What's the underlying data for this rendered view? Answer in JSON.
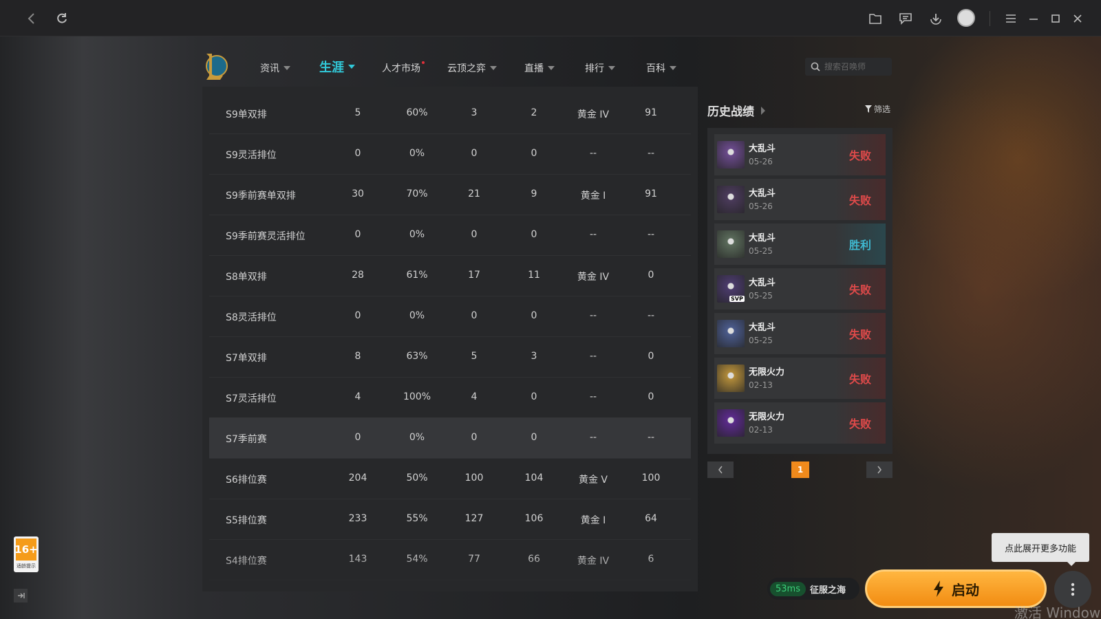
{
  "icons": {
    "back": "back-arrow-icon",
    "refresh": "refresh-icon",
    "folder": "folder-icon",
    "chat": "chat-icon",
    "download": "download-icon",
    "menu": "menu-icon",
    "minimize": "minimize-icon",
    "maximize": "maximize-icon",
    "close": "close-icon",
    "search": "search-icon",
    "filter": "filter-icon",
    "launch": "lightning-icon"
  },
  "nav": {
    "items": [
      {
        "label": "资讯",
        "caret": true
      },
      {
        "label": "生涯",
        "caret": true,
        "active": true
      },
      {
        "label": "人才市场",
        "dot": true
      },
      {
        "label": "云顶之弈",
        "caret": true
      },
      {
        "label": "直播",
        "caret": true
      },
      {
        "label": "排行",
        "caret": true
      },
      {
        "label": "百科",
        "caret": true
      }
    ],
    "search_placeholder": "搜索召唤师"
  },
  "seasons": [
    [
      "S9单双排",
      "5",
      "60%",
      "3",
      "2",
      "黄金 IV",
      "91"
    ],
    [
      "S9灵活排位",
      "0",
      "0%",
      "0",
      "0",
      "--",
      "--"
    ],
    [
      "S9季前赛单双排",
      "30",
      "70%",
      "21",
      "9",
      "黄金 I",
      "91"
    ],
    [
      "S9季前赛灵活排位",
      "0",
      "0%",
      "0",
      "0",
      "--",
      "--"
    ],
    [
      "S8单双排",
      "28",
      "61%",
      "17",
      "11",
      "黄金 IV",
      "0"
    ],
    [
      "S8灵活排位",
      "0",
      "0%",
      "0",
      "0",
      "--",
      "--"
    ],
    [
      "S7单双排",
      "8",
      "63%",
      "5",
      "3",
      "--",
      "0"
    ],
    [
      "S7灵活排位",
      "4",
      "100%",
      "4",
      "0",
      "--",
      "0"
    ],
    [
      "S7季前赛",
      "0",
      "0%",
      "0",
      "0",
      "--",
      "--"
    ],
    [
      "S6排位赛",
      "204",
      "50%",
      "100",
      "104",
      "黄金 V",
      "100"
    ],
    [
      "S5排位赛",
      "233",
      "55%",
      "127",
      "106",
      "黄金 I",
      "64"
    ],
    [
      "S4排位赛",
      "143",
      "54%",
      "77",
      "66",
      "黄金 IV",
      "6"
    ]
  ],
  "history": {
    "title": "历史战绩",
    "filter_label": "筛选",
    "matches": [
      {
        "mode": "大乱斗",
        "date": "05-26",
        "result": "失败",
        "win": false,
        "color": "#6a4a8a"
      },
      {
        "mode": "大乱斗",
        "date": "05-26",
        "result": "失败",
        "win": false,
        "color": "#4a3a5a"
      },
      {
        "mode": "大乱斗",
        "date": "05-25",
        "result": "胜利",
        "win": true,
        "color": "#5a6a5a"
      },
      {
        "mode": "大乱斗",
        "date": "05-25",
        "result": "失败",
        "win": false,
        "color": "#4a3a6a",
        "badge": "SVP"
      },
      {
        "mode": "大乱斗",
        "date": "05-25",
        "result": "失败",
        "win": false,
        "color": "#4a5a8a"
      },
      {
        "mode": "无限火力",
        "date": "02-13",
        "result": "失败",
        "win": false,
        "color": "#b08a3a"
      },
      {
        "mode": "无限火力",
        "date": "02-13",
        "result": "失败",
        "win": false,
        "color": "#5a2a8a"
      }
    ],
    "page": "1"
  },
  "bottom": {
    "tooltip": "点此展开更多功能",
    "ping": "53ms",
    "server": "征服之海",
    "launch_label": "启动",
    "age_rating": "16+",
    "age_sub": "适龄提示",
    "watermark": "激活 Windows"
  }
}
